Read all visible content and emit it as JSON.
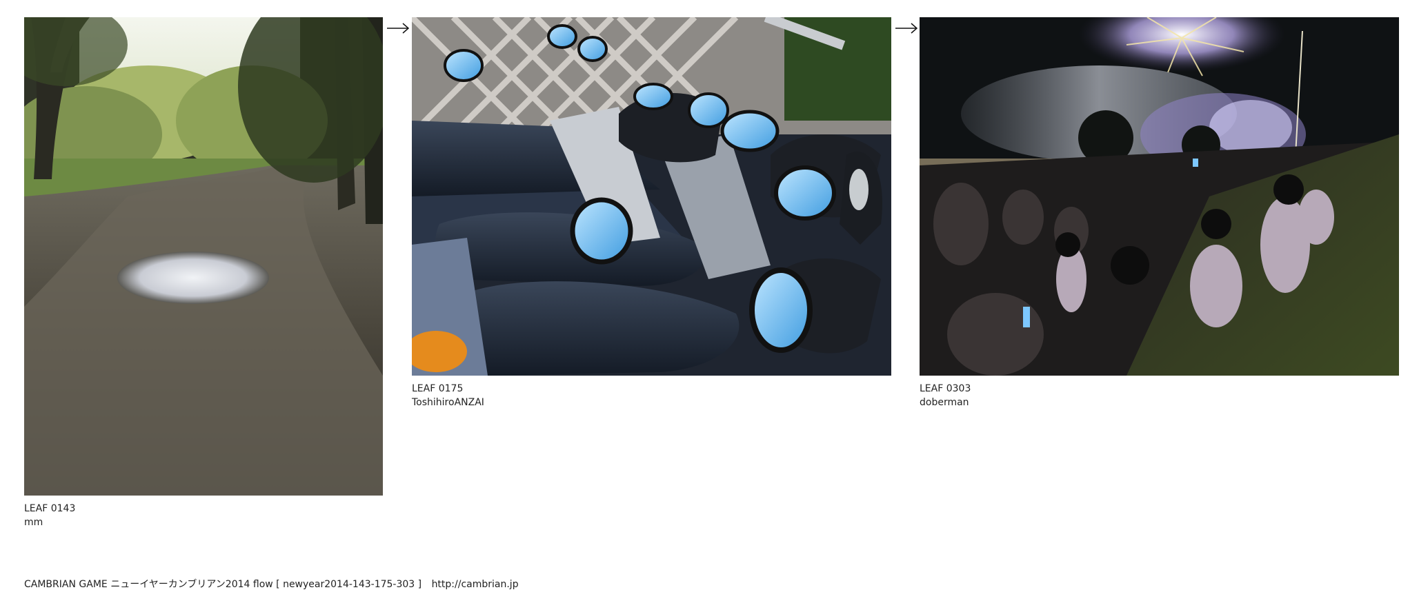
{
  "flow": {
    "leaves": [
      {
        "id_label": "LEAF 0143",
        "author": "mm",
        "image_name": "park-path-puddle-photo"
      },
      {
        "id_label": "LEAF 0175",
        "author": "ToshihiroANZAI",
        "image_name": "parked-scooters-mirrors-photo"
      },
      {
        "id_label": "LEAF 0303",
        "author": "doberman",
        "image_name": "fireworks-crowd-night-photo"
      }
    ],
    "arrow_icon": "right-arrow-icon"
  },
  "footer": {
    "text": "CAMBRIAN GAME  ニューイヤーカンブリアン2014  flow [ newyear2014-143-175-303 ]",
    "link": "http://cambrian.jp"
  },
  "colors": {
    "text": "#222222",
    "background": "#ffffff"
  }
}
